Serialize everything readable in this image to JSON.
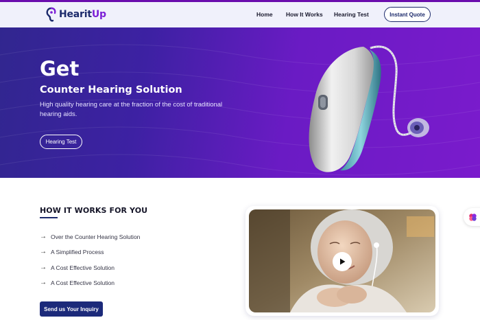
{
  "brand": {
    "name_part1": "Hearit",
    "name_part2": "Up",
    "primary_color": "#1c2a6b",
    "accent_color": "#7b1fd6"
  },
  "nav": {
    "home": "Home",
    "how_it_works": "How It Works",
    "hearing_test": "Hearing Test",
    "quote_button": "Instant Quote"
  },
  "hero": {
    "title": "Get",
    "subtitle": "Counter Hearing Solution",
    "description": "High quality hearing care at the fraction of the cost of traditional hearing aids.",
    "button": "Hearing Test",
    "image_icon": "hearing-aid-image"
  },
  "how_it_works": {
    "title": "HOW IT WORKS FOR YOU",
    "features": [
      "Over the Counter Hearing Solution",
      "A Simplified Process",
      "A Cost Effective Solution",
      "A Cost Effective Solution"
    ],
    "arrow_icon": "arrow-right-icon",
    "inquiry_button": "Send us Your Inquiry"
  },
  "video": {
    "play_icon": "play-icon",
    "image_icon": "woman-listening-image"
  },
  "side_widget": {
    "icon": "brain-icon"
  }
}
